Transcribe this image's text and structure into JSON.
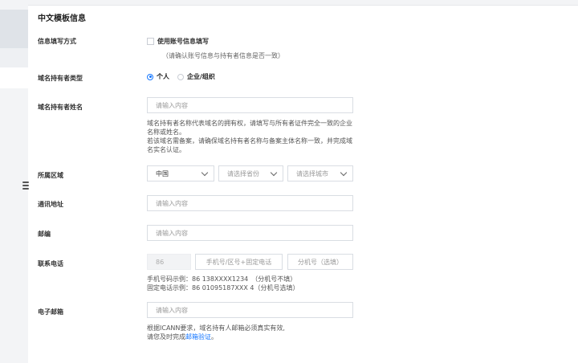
{
  "form": {
    "title": "中文模板信息",
    "fill_method": {
      "label": "信息填写方式",
      "checkbox_label": "使用账号信息填写",
      "hint": "（请确认账号信息与持有者信息是否一致）"
    },
    "holder_type": {
      "label": "域名持有者类型",
      "options": [
        "个人",
        "企业/组织"
      ],
      "selected": "个人"
    },
    "holder_name": {
      "label": "域名持有者姓名",
      "placeholder": "请输入内容",
      "note1": "域名持有者名称代表域名的拥有权，请填写与所有者证件完全一致的企业名称或姓名。",
      "note2": "若该域名需备案，请确保域名持有者名称与备案主体名称一致，并完成域名实名认证。"
    },
    "region": {
      "label": "所属区域",
      "country": "中国",
      "province_placeholder": "请选择省份",
      "city_placeholder": "请选择城市"
    },
    "address": {
      "label": "通讯地址",
      "placeholder": "请输入内容"
    },
    "postcode": {
      "label": "邮编",
      "placeholder": "请输入内容"
    },
    "phone": {
      "label": "联系电话",
      "country_code": "86",
      "number_placeholder": "手机号/区号+固定电话",
      "ext_placeholder": "分机号（选填）",
      "example_mobile": "手机号码示例：86 138XXXX1234　（分机号不填）",
      "example_fixed": "固定电话示例：86 01095187XXX 4（分机号选填）"
    },
    "email": {
      "label": "电子邮箱",
      "placeholder": "请输入内容",
      "note1": "根据ICANN要求，域名持有人邮箱必须真实有效,",
      "note2_prefix": "请您及时完成",
      "note2_link": "邮箱验证",
      "note2_suffix": "。"
    }
  }
}
